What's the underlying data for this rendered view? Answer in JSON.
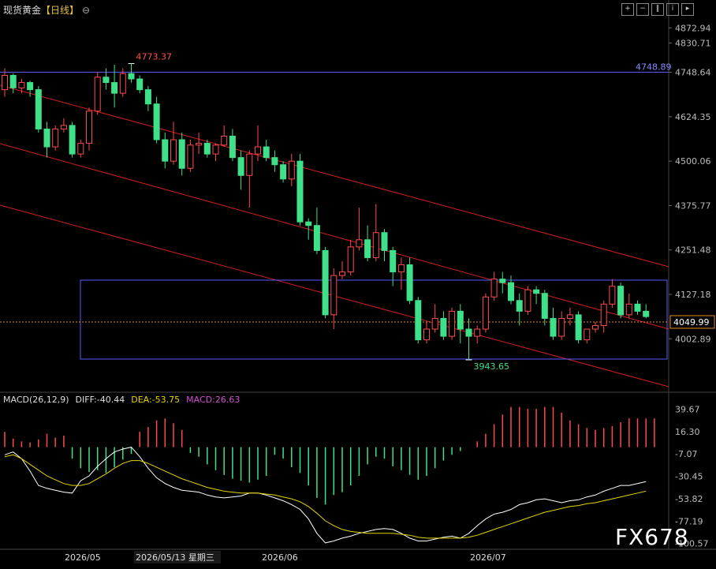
{
  "header": {
    "symbol": "现货黄金",
    "period": "【日线】",
    "settings_icon": "settings-circle-icon",
    "toolbar": [
      "zoom-in-icon",
      "zoom-out-icon",
      "chart-type-icon",
      "info-icon",
      "next-icon"
    ]
  },
  "watermark": "FX678",
  "colors": {
    "up": "#ff4a4a",
    "down": "#3ee08a",
    "line_red": "#d21f1f",
    "box": "#5a5aff",
    "dif": "#ffffff",
    "dea": "#e6d400",
    "last_price": "#e88a20"
  },
  "price_labels": {
    "ticks": [
      "4872.94",
      "4830.71",
      "4748.64",
      "4624.35",
      "4500.06",
      "4375.77",
      "4251.48",
      "4127.18",
      "4002.89"
    ],
    "hline_value": "4748.89",
    "high_label": "4773.37",
    "low_label": "3943.65",
    "last_price": "4049.99"
  },
  "chart_data": {
    "type": "candlestick",
    "x_labels": [
      "2026/05",
      "2026/05/13 星期三",
      "2026/06",
      "2026/07"
    ],
    "ohlc": [
      [
        4700,
        4760,
        4680,
        4740
      ],
      [
        4740,
        4745,
        4690,
        4705
      ],
      [
        4705,
        4730,
        4690,
        4720
      ],
      [
        4720,
        4725,
        4680,
        4700
      ],
      [
        4700,
        4710,
        4580,
        4590
      ],
      [
        4590,
        4610,
        4510,
        4540
      ],
      [
        4540,
        4600,
        4530,
        4590
      ],
      [
        4590,
        4620,
        4580,
        4600
      ],
      [
        4600,
        4610,
        4510,
        4520
      ],
      [
        4520,
        4560,
        4510,
        4550
      ],
      [
        4550,
        4650,
        4530,
        4640
      ],
      [
        4640,
        4750,
        4630,
        4735
      ],
      [
        4735,
        4760,
        4700,
        4720
      ],
      [
        4720,
        4770,
        4650,
        4690
      ],
      [
        4690,
        4760,
        4680,
        4745
      ],
      [
        4745,
        4773,
        4720,
        4730
      ],
      [
        4730,
        4740,
        4690,
        4700
      ],
      [
        4700,
        4710,
        4640,
        4660
      ],
      [
        4660,
        4680,
        4550,
        4560
      ],
      [
        4560,
        4580,
        4480,
        4500
      ],
      [
        4500,
        4610,
        4490,
        4560
      ],
      [
        4560,
        4580,
        4460,
        4480
      ],
      [
        4480,
        4560,
        4470,
        4545
      ],
      [
        4545,
        4580,
        4520,
        4550
      ],
      [
        4550,
        4560,
        4510,
        4520
      ],
      [
        4520,
        4550,
        4500,
        4545
      ],
      [
        4545,
        4600,
        4540,
        4570
      ],
      [
        4570,
        4590,
        4500,
        4510
      ],
      [
        4510,
        4530,
        4420,
        4460
      ],
      [
        4460,
        4530,
        4370,
        4520
      ],
      [
        4520,
        4600,
        4500,
        4540
      ],
      [
        4540,
        4560,
        4500,
        4510
      ],
      [
        4510,
        4530,
        4470,
        4490
      ],
      [
        4490,
        4500,
        4440,
        4450
      ],
      [
        4450,
        4520,
        4430,
        4500
      ],
      [
        4500,
        4520,
        4320,
        4330
      ],
      [
        4330,
        4340,
        4280,
        4320
      ],
      [
        4320,
        4370,
        4240,
        4250
      ],
      [
        4250,
        4260,
        4060,
        4070
      ],
      [
        4070,
        4200,
        4030,
        4180
      ],
      [
        4180,
        4220,
        4170,
        4190
      ],
      [
        4190,
        4280,
        4180,
        4260
      ],
      [
        4260,
        4370,
        4250,
        4280
      ],
      [
        4280,
        4320,
        4220,
        4230
      ],
      [
        4230,
        4380,
        4220,
        4300
      ],
      [
        4300,
        4310,
        4220,
        4250
      ],
      [
        4250,
        4260,
        4150,
        4190
      ],
      [
        4190,
        4230,
        4140,
        4210
      ],
      [
        4210,
        4230,
        4100,
        4110
      ],
      [
        4110,
        4120,
        3990,
        4000
      ],
      [
        4000,
        4050,
        3990,
        4030
      ],
      [
        4030,
        4100,
        4020,
        4060
      ],
      [
        4060,
        4080,
        4000,
        4010
      ],
      [
        4010,
        4090,
        4000,
        4080
      ],
      [
        4080,
        4100,
        3990,
        4030
      ],
      [
        4030,
        4060,
        3944,
        4010
      ],
      [
        4010,
        4040,
        3990,
        4030
      ],
      [
        4030,
        4130,
        4020,
        4120
      ],
      [
        4120,
        4190,
        4110,
        4170
      ],
      [
        4170,
        4190,
        4130,
        4160
      ],
      [
        4160,
        4180,
        4100,
        4110
      ],
      [
        4110,
        4130,
        4040,
        4080
      ],
      [
        4080,
        4150,
        4070,
        4140
      ],
      [
        4140,
        4150,
        4100,
        4130
      ],
      [
        4130,
        4140,
        4040,
        4060
      ],
      [
        4060,
        4090,
        4000,
        4010
      ],
      [
        4010,
        4080,
        4000,
        4060
      ],
      [
        4060,
        4090,
        4040,
        4070
      ],
      [
        4070,
        4080,
        3990,
        4000
      ],
      [
        4000,
        4030,
        3990,
        4030
      ],
      [
        4030,
        4050,
        4020,
        4040
      ],
      [
        4040,
        4110,
        4020,
        4100
      ],
      [
        4100,
        4170,
        4090,
        4150
      ],
      [
        4150,
        4160,
        4060,
        4070
      ],
      [
        4070,
        4130,
        4060,
        4100
      ],
      [
        4100,
        4110,
        4070,
        4080
      ],
      [
        4080,
        4100,
        4060,
        4065
      ]
    ],
    "price_axis_range": [
      3860,
      4920
    ],
    "channel_lines_note": "three parallel descending red trend lines",
    "macd": {
      "legend": "MACD(26,12,9)",
      "diff_label": "DIFF:-40.44",
      "dea_label": "DEA:-53.75",
      "macd_label": "MACD:26.63",
      "ticks": [
        "39.67",
        "16.30",
        "-7.07",
        "-30.45",
        "-53.82",
        "-77.19",
        "-100.57"
      ],
      "range": [
        -105,
        45
      ],
      "hist": [
        16,
        9,
        6,
        5,
        8,
        14,
        10,
        12,
        -12,
        -22,
        -26,
        -24,
        -27,
        -21,
        -13,
        -7,
        16,
        21,
        28,
        30,
        25,
        18,
        -6,
        -10,
        -18,
        -24,
        -29,
        -33,
        -35,
        -37,
        -34,
        -30,
        -8,
        -12,
        -21,
        -27,
        -40,
        -53,
        -60,
        -50,
        -47,
        -40,
        -30,
        -18,
        -10,
        -12,
        -20,
        -24,
        -29,
        -34,
        -30,
        -22,
        -14,
        -8,
        -4,
        0,
        6,
        14,
        24,
        34,
        42,
        42,
        40,
        40,
        42,
        42,
        36,
        28,
        24,
        20,
        18,
        20,
        22,
        26,
        30,
        30,
        30,
        30
      ],
      "dif": [
        -8,
        -5,
        -12,
        -25,
        -40,
        -43,
        -45,
        -47,
        -48,
        -35,
        -30,
        -20,
        -12,
        -5,
        -2,
        0,
        -10,
        -22,
        -32,
        -38,
        -42,
        -45,
        -46,
        -47,
        -50,
        -52,
        -53,
        -52,
        -51,
        -48,
        -48,
        -50,
        -53,
        -56,
        -60,
        -65,
        -75,
        -90,
        -100,
        -98,
        -95,
        -93,
        -90,
        -88,
        -86,
        -85,
        -86,
        -90,
        -95,
        -98,
        -98,
        -96,
        -94,
        -93,
        -95,
        -90,
        -82,
        -75,
        -70,
        -68,
        -65,
        -60,
        -58,
        -55,
        -54,
        -56,
        -58,
        -56,
        -55,
        -52,
        -50,
        -46,
        -43,
        -40,
        -40,
        -38,
        -36
      ],
      "dea": [
        -10,
        -8,
        -12,
        -18,
        -24,
        -30,
        -34,
        -38,
        -40,
        -40,
        -38,
        -33,
        -28,
        -22,
        -17,
        -14,
        -14,
        -17,
        -21,
        -25,
        -29,
        -33,
        -36,
        -39,
        -42,
        -44,
        -46,
        -47,
        -48,
        -48,
        -48,
        -49,
        -50,
        -52,
        -54,
        -57,
        -62,
        -69,
        -77,
        -82,
        -86,
        -88,
        -89,
        -90,
        -90,
        -90,
        -90,
        -91,
        -92,
        -94,
        -95,
        -95,
        -95,
        -95,
        -95,
        -94,
        -92,
        -89,
        -86,
        -83,
        -80,
        -77,
        -74,
        -71,
        -68,
        -66,
        -64,
        -62,
        -61,
        -59,
        -58,
        -56,
        -54,
        -52,
        -50,
        -48,
        -46
      ]
    }
  }
}
